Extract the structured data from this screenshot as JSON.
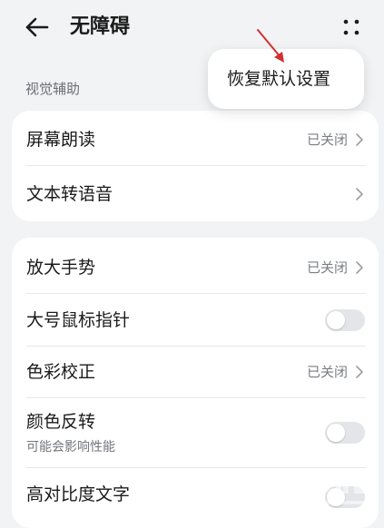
{
  "header": {
    "title": "无障碍",
    "back_icon": "back-arrow-icon",
    "more_icon": "more-dots-icon"
  },
  "popup_menu": {
    "items": [
      {
        "label": "恢复默认设置"
      }
    ]
  },
  "sections": [
    {
      "label": "视觉辅助",
      "items": [
        {
          "label": "屏幕朗读",
          "value": "已关闭",
          "control": "chevron"
        },
        {
          "label": "文本转语音",
          "value": "",
          "control": "chevron"
        }
      ]
    },
    {
      "label": "",
      "items": [
        {
          "label": "放大手势",
          "value": "已关闭",
          "control": "chevron"
        },
        {
          "label": "大号鼠标指针",
          "control": "toggle",
          "toggle_on": false
        },
        {
          "label": "色彩校正",
          "value": "已关闭",
          "control": "chevron"
        },
        {
          "label": "颜色反转",
          "sublabel": "可能会影响性能",
          "control": "toggle",
          "toggle_on": false
        },
        {
          "label": "高对比度文字",
          "control": "toggle",
          "toggle_on": false
        }
      ]
    }
  ],
  "annotation": {
    "arrow_color": "#d32f2f"
  },
  "colors": {
    "background": "#f1f3f5",
    "card": "#ffffff",
    "toggle_off": "#e3e5e8",
    "secondary_text": "#7a7e83"
  }
}
